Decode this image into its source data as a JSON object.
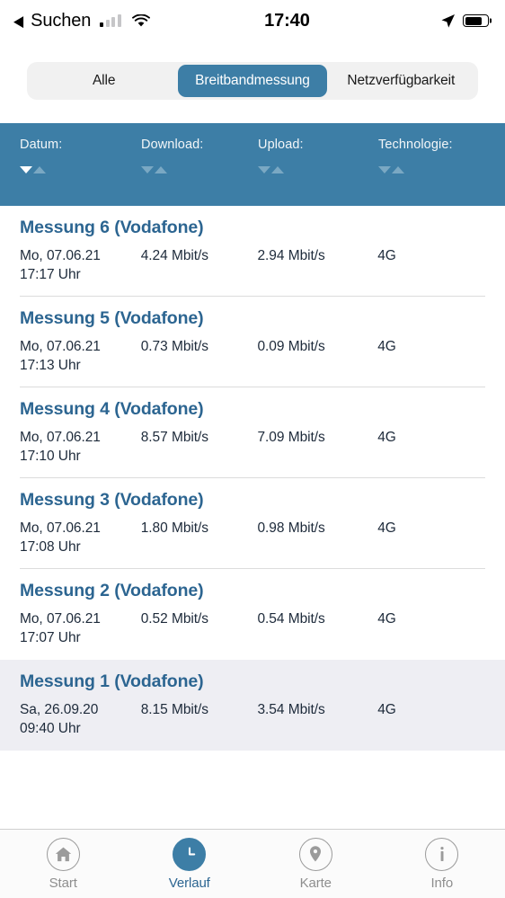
{
  "status_bar": {
    "back_glyph": "◀",
    "carrier_label": "Suchen",
    "time": "17:40",
    "signal_icon": "cellular-signal-icon",
    "wifi_icon": "wifi-icon",
    "location_icon": "location-arrow-icon",
    "battery_icon": "battery-icon",
    "battery_percent": 75
  },
  "segmented_control": {
    "options": [
      {
        "label": "Alle",
        "active": false
      },
      {
        "label": "Breitbandmessung",
        "active": true
      },
      {
        "label": "Netzverfügbarkeit",
        "active": false
      }
    ],
    "active_color": "#3d7ea6",
    "track_color": "#f1f1f1"
  },
  "table": {
    "header_color": "#3d7ea6",
    "columns": [
      {
        "label": "Datum:",
        "sort_down_active": true,
        "sort_up_active": false
      },
      {
        "label": "Download:",
        "sort_down_active": false,
        "sort_up_active": false
      },
      {
        "label": "Upload:",
        "sort_down_active": false,
        "sort_up_active": false
      },
      {
        "label": "Technologie:",
        "sort_down_active": false,
        "sort_up_active": false
      }
    ],
    "rows": [
      {
        "title": "Messung 6 (Vodafone)",
        "date": "Mo, 07.06.21",
        "time": "17:17 Uhr",
        "download": "4.24 Mbit/s",
        "upload": "2.94 Mbit/s",
        "technology": "4G",
        "highlight": false
      },
      {
        "title": "Messung 5 (Vodafone)",
        "date": "Mo, 07.06.21",
        "time": "17:13 Uhr",
        "download": "0.73 Mbit/s",
        "upload": "0.09 Mbit/s",
        "technology": "4G",
        "highlight": false
      },
      {
        "title": "Messung 4 (Vodafone)",
        "date": "Mo, 07.06.21",
        "time": "17:10 Uhr",
        "download": "8.57 Mbit/s",
        "upload": "7.09 Mbit/s",
        "technology": "4G",
        "highlight": false
      },
      {
        "title": "Messung 3 (Vodafone)",
        "date": "Mo, 07.06.21",
        "time": "17:08 Uhr",
        "download": "1.80 Mbit/s",
        "upload": "0.98 Mbit/s",
        "technology": "4G",
        "highlight": false
      },
      {
        "title": "Messung 2 (Vodafone)",
        "date": "Mo, 07.06.21",
        "time": "17:07 Uhr",
        "download": "0.52 Mbit/s",
        "upload": "0.54 Mbit/s",
        "technology": "4G",
        "highlight": false
      },
      {
        "title": "Messung 1 (Vodafone)",
        "date": "Sa, 26.09.20",
        "time": "09:40 Uhr",
        "download": "8.15 Mbit/s",
        "upload": "3.54 Mbit/s",
        "technology": "4G",
        "highlight": true
      }
    ]
  },
  "tabbar": {
    "items": [
      {
        "label": "Start",
        "icon": "home-icon",
        "active": false
      },
      {
        "label": "Verlauf",
        "icon": "clock-icon",
        "active": true
      },
      {
        "label": "Karte",
        "icon": "map-pin-icon",
        "active": false
      },
      {
        "label": "Info",
        "icon": "info-icon",
        "active": false
      }
    ],
    "active_color": "#2c6591",
    "inactive_color": "#8e8e8e"
  }
}
